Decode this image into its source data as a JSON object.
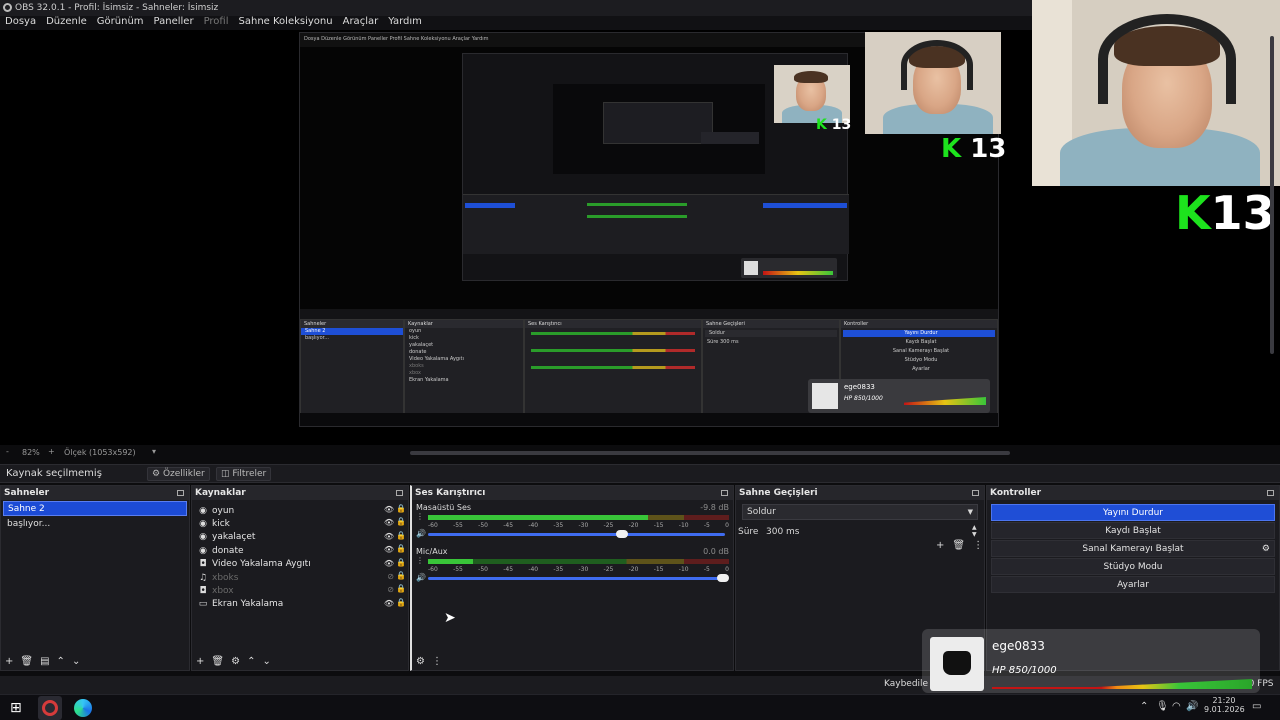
{
  "window": {
    "title": "OBS 32.0.1 - Profil: İsimsiz - Sahneler: İsimsiz"
  },
  "menu": [
    "Dosya",
    "Düzenle",
    "Görünüm",
    "Paneller",
    "Profil",
    "Sahne Koleksiyonu",
    "Araçlar",
    "Yardım"
  ],
  "preview": {
    "nested_menu": "Dosya  Düzenle  Görünüm  Paneller  Profil  Sahne Koleksiyonu  Araçlar  Yardım",
    "webcam_text_big": "13",
    "webcam_text_k": "K"
  },
  "zoom_bar": {
    "zoom": "82%",
    "minus": "-",
    "plus": "+",
    "size": "Ölçek (1053x592)"
  },
  "source_toolbar": {
    "label": "Kaynak seçilmemiş",
    "properties": "Özellikler",
    "filters": "Filtreler"
  },
  "scenes": {
    "title": "Sahneler",
    "items": [
      "Sahne 2",
      "başlıyor..."
    ]
  },
  "sources": {
    "title": "Kaynaklar",
    "items": [
      {
        "name": "oyun",
        "icon": "game-icon",
        "visible": true
      },
      {
        "name": "kick",
        "icon": "browser-icon",
        "visible": true
      },
      {
        "name": "yakalaçet",
        "icon": "browser-icon",
        "visible": true
      },
      {
        "name": "donate",
        "icon": "browser-icon",
        "visible": true
      },
      {
        "name": "Video Yakalama Aygıtı",
        "icon": "camera-icon",
        "visible": true
      },
      {
        "name": "xboks",
        "icon": "mic-icon",
        "visible": false
      },
      {
        "name": "xbox",
        "icon": "camera-icon",
        "visible": false
      },
      {
        "name": "Ekran Yakalama",
        "icon": "monitor-icon",
        "visible": true
      }
    ]
  },
  "mixer": {
    "title": "Ses Karıştırıcı",
    "channels": [
      {
        "name": "Masaüstü Ses",
        "db": "-9.8 dB",
        "level": 0.73,
        "volume": 0.66
      },
      {
        "name": "Mic/Aux",
        "db": "0.0 dB",
        "level": 0.15,
        "volume": 1.0
      }
    ],
    "ticks": [
      "-60",
      "-55",
      "-50",
      "-45",
      "-40",
      "-35",
      "-30",
      "-25",
      "-20",
      "-15",
      "-10",
      "-5",
      "0"
    ]
  },
  "transitions": {
    "title": "Sahne Geçişleri",
    "type": "Soldur",
    "duration_label": "Süre",
    "duration_value": "300 ms"
  },
  "controls": {
    "title": "Kontroller",
    "buttons": [
      "Yayını Durdur",
      "Kaydı Başlat",
      "Sanal Kamerayı Başlat",
      "Stüdyo Modu",
      "Ayarlar"
    ]
  },
  "overlay": {
    "username": "ege0833",
    "hp": "HP 850/1000"
  },
  "statusbar": {
    "dropped": "Kaybedile",
    "fps": ".00 FPS"
  },
  "taskbar": {
    "time": "21:20",
    "date": "9.01.2026"
  },
  "colors": {
    "accent": "#1f4ed6",
    "kick_green": "#1de31d",
    "background": "#1b1b1f"
  }
}
